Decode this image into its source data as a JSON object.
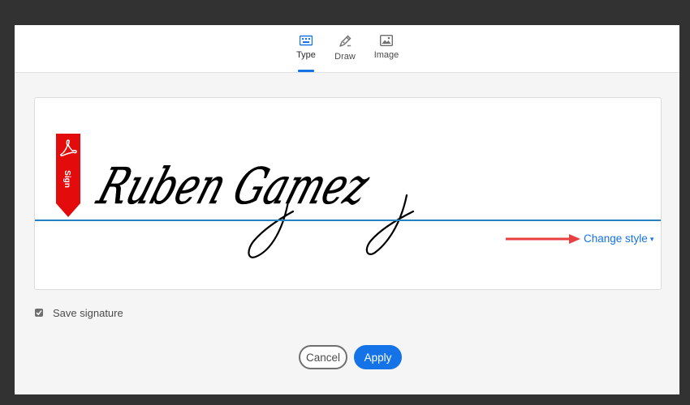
{
  "tabs": [
    {
      "label": "Type",
      "icon": "keyboard-icon",
      "active": true
    },
    {
      "label": "Draw",
      "icon": "pen-icon",
      "active": false
    },
    {
      "label": "Image",
      "icon": "image-icon",
      "active": false
    }
  ],
  "signature": {
    "text": "Ruben Gamez",
    "flag_label": "Sign",
    "flag_icon": "acrobat-icon",
    "flag_color": "#e30b0b"
  },
  "change_style": {
    "label": "Change style",
    "caret": "▾"
  },
  "save_signature": {
    "label": "Save signature",
    "checked": true
  },
  "buttons": {
    "cancel_label": "Cancel",
    "apply_label": "Apply"
  },
  "colors": {
    "accent": "#1473e6",
    "annotation_arrow": "#e84040"
  }
}
